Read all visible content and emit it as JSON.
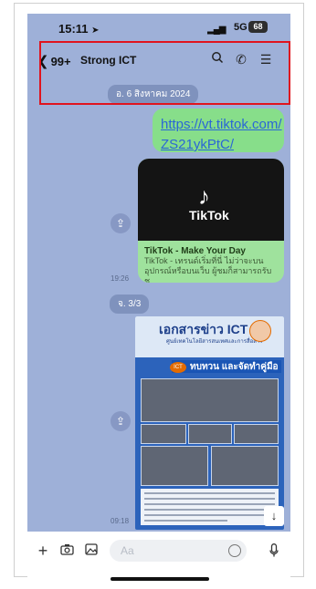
{
  "status_bar": {
    "time": "15:11",
    "network": "5G",
    "battery": "68"
  },
  "header": {
    "back_count": "99+",
    "title": "Strong ICT"
  },
  "date_separator": "อ. 6 สิงหาคม 2024",
  "link_message": {
    "line1": "https://vt.tiktok.com/",
    "line2": "ZS21ykPtC/"
  },
  "preview_card": {
    "brand": "TikTok",
    "title": "TikTok - Make Your Day",
    "desc_line1": "TikTok - เทรนด์เริ่มที่นี่ ไม่ว่าจะบน",
    "desc_line2": "อุปกรณ์หรือบนเว็บ ผู้ชมก็สามารถรับช...",
    "time": "19:26"
  },
  "day_separator": "จ. 3/3",
  "image_message": {
    "doc_title": "เอกสารข่าว ICT",
    "doc_subtitle": "ศูนย์เทคโนโลยีสารสนเทศและการสื่อสาร",
    "doc_banner": "ทบทวน และจัดทำคู่มือ",
    "time": "09:18"
  },
  "composer": {
    "placeholder": "Aa"
  }
}
